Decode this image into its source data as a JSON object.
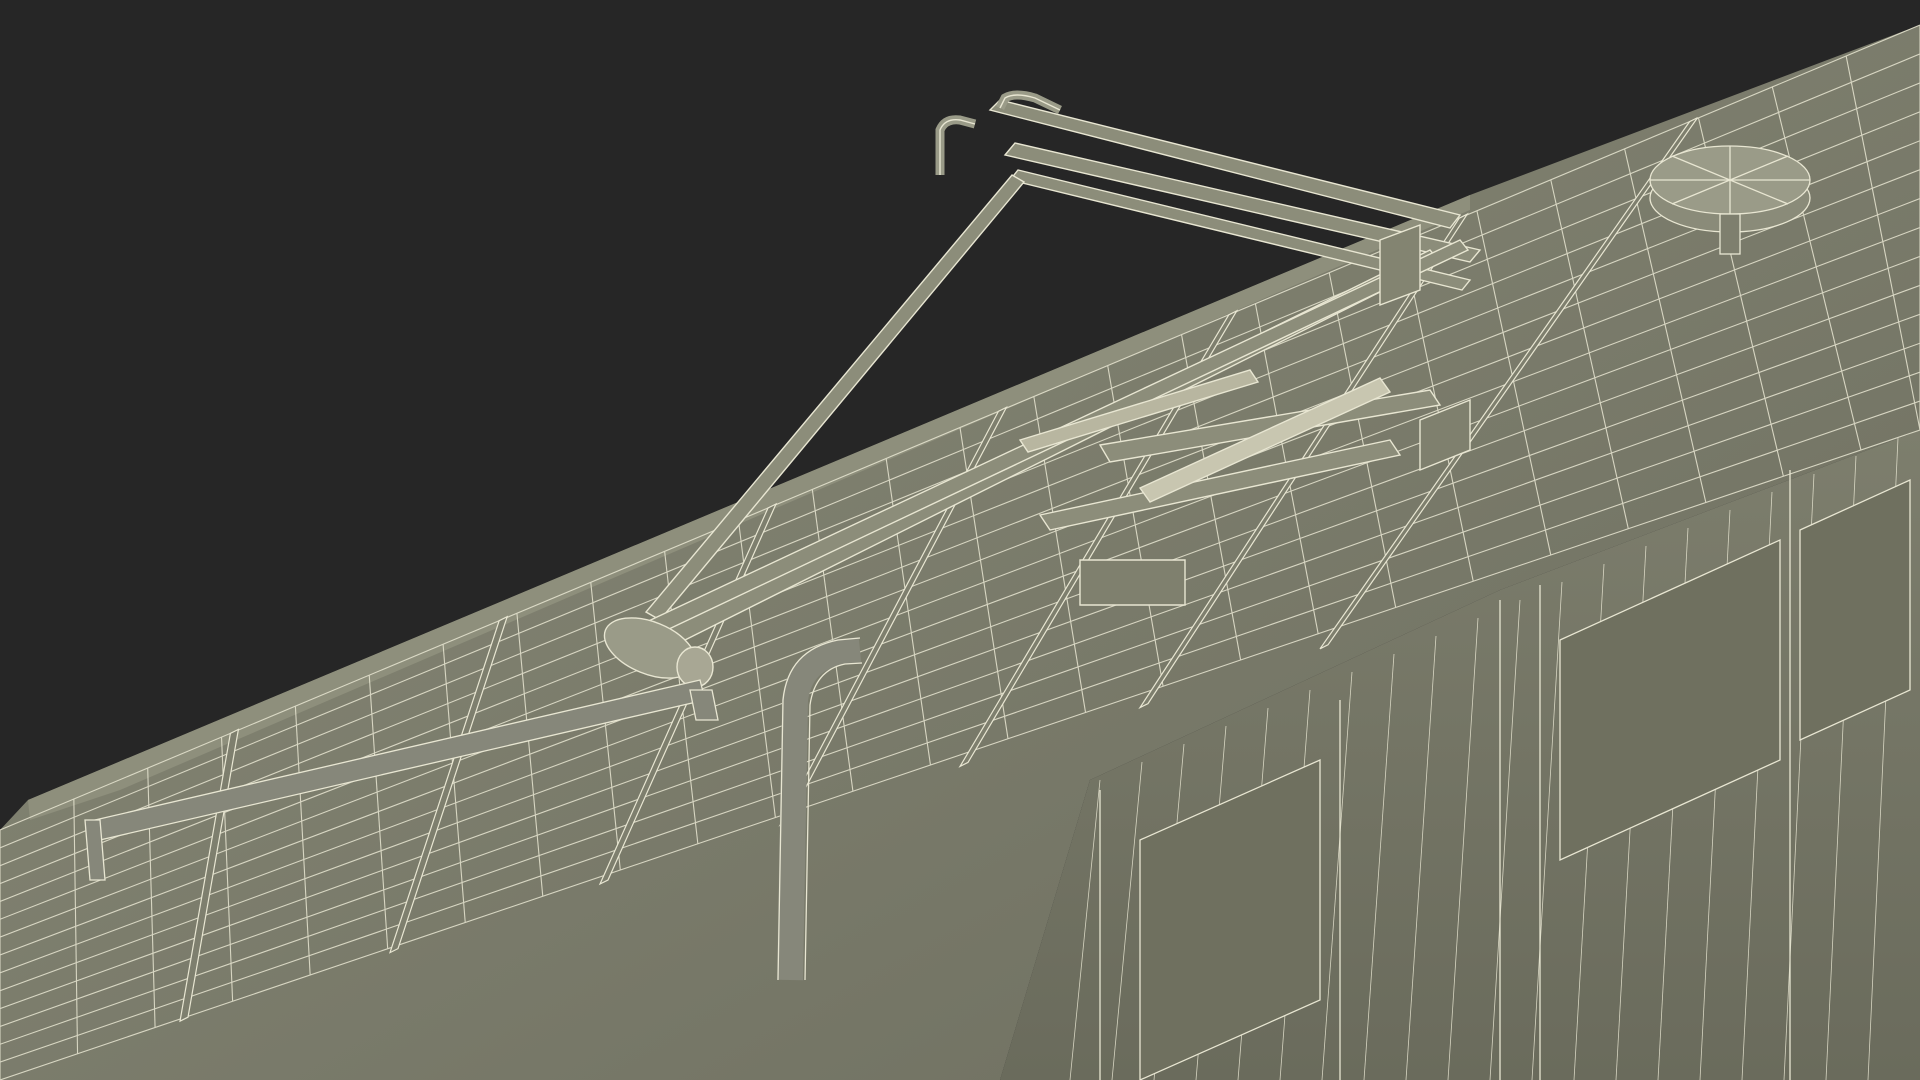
{
  "scene": {
    "background_color": "#262626",
    "surface_color": "#7a7b6b",
    "surface_shadow_color": "#6a6b5c",
    "wire_color": "#e8e6d2",
    "subject": "wireframe-train-roof-pantograph"
  }
}
